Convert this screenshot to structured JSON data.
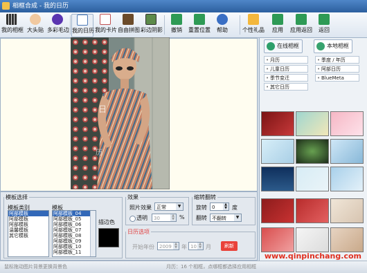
{
  "window": {
    "title": "相框合成 - 我的日历"
  },
  "toolbar": {
    "items": [
      {
        "label": "我的相框",
        "icon": "film-icon"
      },
      {
        "label": "大头贴",
        "icon": "sticker-icon"
      },
      {
        "label": "多彩毛边",
        "icon": "flower-icon"
      },
      {
        "label": "我的日历",
        "icon": "calendar-icon"
      },
      {
        "label": "我的卡片",
        "icon": "card-icon"
      },
      {
        "label": "自由拼图",
        "icon": "puzzle-icon"
      },
      {
        "label": "彩边阴影",
        "icon": "shadow-icon"
      },
      {
        "label": "撤销",
        "icon": "undo-icon"
      },
      {
        "label": "重置位置",
        "icon": "reset-icon"
      },
      {
        "label": "帮助",
        "icon": "help-icon"
      },
      {
        "label": "个性礼品",
        "icon": "gift-icon"
      },
      {
        "label": "应用",
        "icon": "apply-icon"
      },
      {
        "label": "应用返回",
        "icon": "apply-return-icon"
      },
      {
        "label": "返回",
        "icon": "back-icon"
      }
    ]
  },
  "right_panel": {
    "tabs": [
      {
        "label": "在线相框",
        "icon": "globe-icon"
      },
      {
        "label": "本地相框",
        "icon": "folder-icon"
      }
    ],
    "categories": [
      "月历",
      "季度 / 年历",
      "儿童日历",
      "阿部日历",
      "季节变迁",
      "BlueMeta",
      "其它日历"
    ]
  },
  "bottom_panel": {
    "template_group": {
      "legend": "模板选择",
      "type_label": "模板类别",
      "template_label": "模板",
      "types": [
        "阿部模板",
        "阿部模板",
        "阿部模板",
        "温馨模板",
        "其它模板"
      ],
      "templates": [
        "阿部模板_04",
        "阿部模板_05",
        "阿部模板_06",
        "阿部模板_07",
        "阿部模板_08",
        "阿部模板_09",
        "阿部模板_10",
        "阿部模板_11"
      ],
      "border_color_label": "描边色"
    },
    "effect_group": {
      "legend": "效果",
      "effect_label": "照片效果",
      "effect_value": "正常",
      "transparency_label": "透明",
      "transparency_value": "30",
      "percent": "%"
    },
    "rotate_group": {
      "legend": "缩转翻转",
      "rotate_label": "旋转",
      "rotate_value": "0",
      "degree": "度",
      "flip_label": "翻转",
      "flip_value": "不翻转"
    },
    "calendar_group": {
      "legend": "日历选项",
      "start_label": "开始年份",
      "year_value": "2009",
      "year_unit": "年",
      "month_value": "10",
      "month_unit": "月",
      "button": "刷新"
    }
  },
  "status": {
    "left": "鼠标拖动图片背景更换背景色",
    "right": "月历：16 个相框，点哪框都选择应用相框"
  },
  "watermark": "www.qinpinchang.com",
  "colors": {
    "titlebar": "#2c5f9e",
    "accent": "#3268b8",
    "watermark": "#e03020"
  }
}
